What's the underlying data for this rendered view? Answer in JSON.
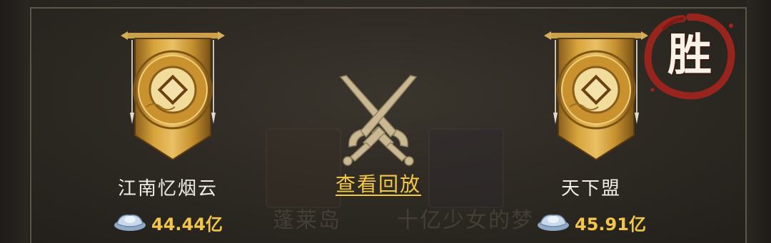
{
  "colors": {
    "background": "#2b2721",
    "gold": "#f4c845",
    "text": "#f2ede4",
    "win_red": "#a3251d"
  },
  "left_team": {
    "name": "江南忆烟云",
    "wealth": "44.44亿",
    "banner_icon": "guild-banner-icon",
    "currency_icon": "silver-ingot-icon"
  },
  "right_team": {
    "name": "天下盟",
    "wealth": "45.91亿",
    "banner_icon": "guild-banner-icon",
    "currency_icon": "silver-ingot-icon",
    "result_badge": "胜"
  },
  "center": {
    "icon": "crossed-swords-icon",
    "replay_label": "查看回放"
  },
  "background_hints": {
    "left_name": "蓬莱岛",
    "right_name": "十亿少女的梦"
  }
}
